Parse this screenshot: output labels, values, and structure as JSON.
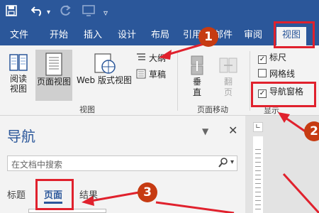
{
  "qat": {
    "save_icon": "save-icon",
    "undo_icon": "undo-icon",
    "redo_icon": "redo-icon",
    "screen_icon": "touch-mode-icon",
    "customize_icon": "customize-qat-icon"
  },
  "tabs": [
    "文件",
    "开始",
    "插入",
    "设计",
    "布局",
    "引用",
    "邮件",
    "审阅",
    "视图"
  ],
  "ribbon": {
    "views": {
      "read_mode": "阅读视图",
      "print_layout": "页面视图",
      "web_layout": "Web 版式视图",
      "outline": "大纲",
      "draft": "草稿",
      "group_label": "视图"
    },
    "page_movement": {
      "vertical": "垂直",
      "side_to_side": "翻页",
      "group_label": "页面移动"
    },
    "show": {
      "ruler": "标尺",
      "ruler_checked": true,
      "gridlines": "网格线",
      "gridlines_checked": false,
      "nav_pane": "导航窗格",
      "nav_pane_checked": true,
      "group_label": "显示"
    }
  },
  "nav_pane": {
    "title": "导航",
    "dropdown_icon": "chevron-down-icon",
    "close_icon": "close-icon",
    "search_placeholder": "在文档中搜索",
    "tabs": [
      "标题",
      "页面",
      "结果"
    ],
    "active_tab": "页面"
  },
  "annotations": {
    "step1": "1",
    "step2": "2",
    "step3": "3",
    "color": "#e0212d"
  }
}
